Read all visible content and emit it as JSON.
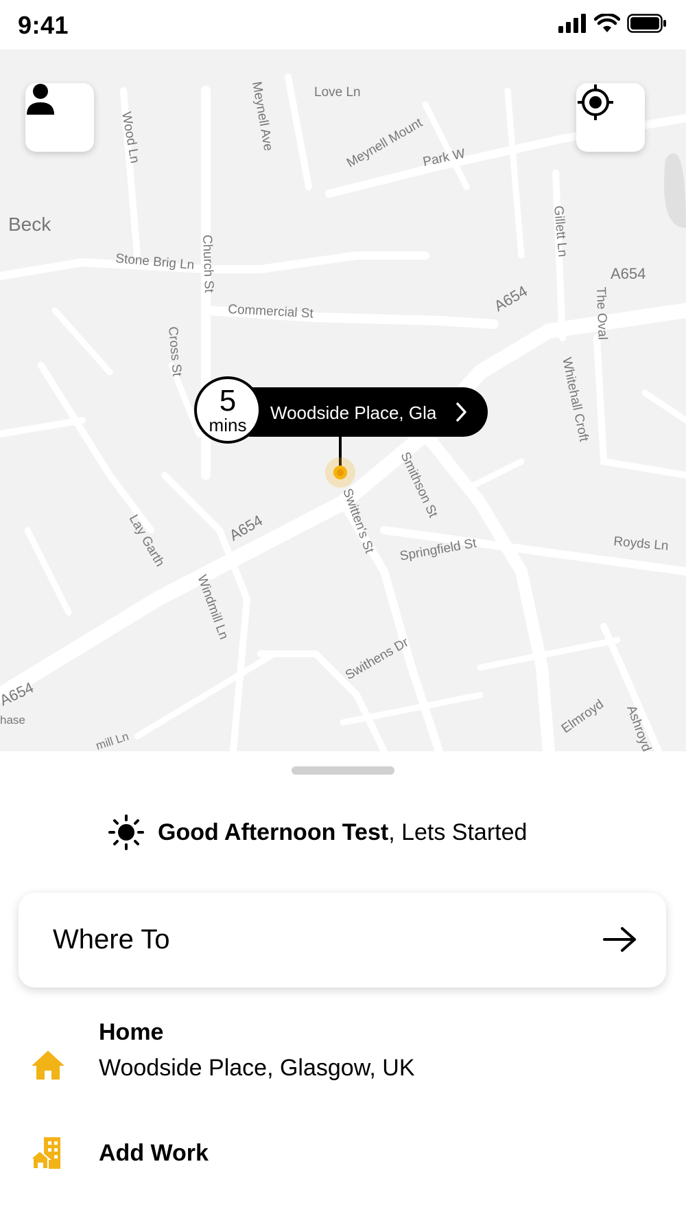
{
  "status_bar": {
    "time": "9:41"
  },
  "map": {
    "street_labels": [
      "Love Ln",
      "Meynell Ave",
      "Meynell Mount",
      "Park W",
      "Wood Ln",
      "Beck",
      "Stone Brig Ln",
      "Church St",
      "Commercial St",
      "Cross St",
      "Gillett Ln",
      "A654",
      "A654",
      "The Oval",
      "Whitehall Croft",
      "Smithson St",
      "Switten's St",
      "Springfield St",
      "Royds Ln",
      "Lay Garth",
      "Windmill Ln",
      "A654",
      "Swithens Dr",
      "A654",
      "Elmroyd",
      "Ashroyd",
      "hase",
      "mill Ln"
    ],
    "pin": {
      "eta_number": "5",
      "eta_unit": "mins",
      "address": "Woodside Place, Gla"
    }
  },
  "sheet": {
    "greeting_bold": "Good Afternoon Test",
    "greeting_rest": ", Lets Started",
    "where_to": "Where To",
    "home_title": "Home",
    "home_address": "Woodside Place, Glasgow, UK",
    "work_title": "Add Work"
  },
  "colors": {
    "accent": "#F2B317",
    "map_bg": "#F2F2F2"
  }
}
